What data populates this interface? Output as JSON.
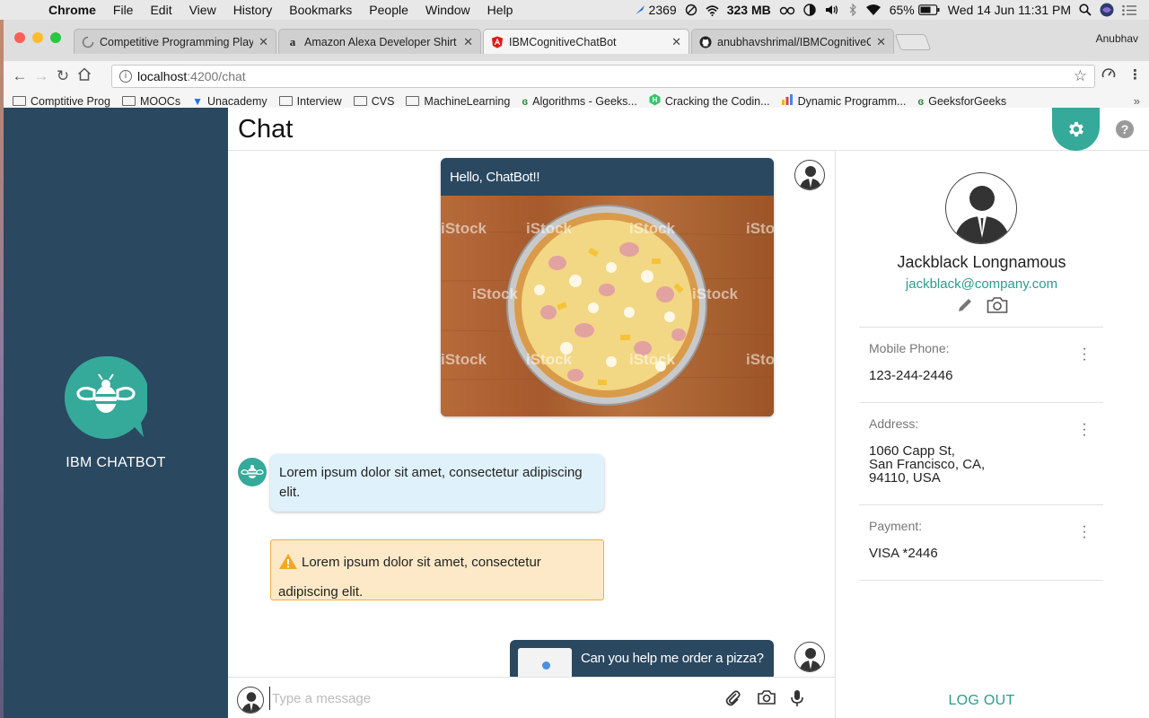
{
  "menubar": {
    "app_name": "Chrome",
    "items": [
      "File",
      "Edit",
      "View",
      "History",
      "Bookmarks",
      "People",
      "Window",
      "Help"
    ],
    "status_count": "2369",
    "memory": "323 MB",
    "battery": "65%",
    "clock": "Wed 14 Jun  11:31 PM"
  },
  "browser": {
    "tabs": [
      {
        "label": "Competitive Programming Play",
        "icon": "loading-icon"
      },
      {
        "label": "Amazon Alexa Developer Shirt",
        "icon": "amazon-icon"
      },
      {
        "label": "IBMCognitiveChatBot",
        "icon": "angular-icon"
      },
      {
        "label": "anubhavshrimal/IBMCognitiveC",
        "icon": "github-icon"
      }
    ],
    "profile": "Anubhav",
    "url_host": "localhost",
    "url_path": ":4200/chat",
    "bookmarks": [
      {
        "label": "Comptitive Prog",
        "icon": "folder-icon"
      },
      {
        "label": "MOOCs",
        "icon": "folder-icon"
      },
      {
        "label": "Unacademy",
        "icon": "unacademy-icon"
      },
      {
        "label": "Interview",
        "icon": "folder-icon"
      },
      {
        "label": "CVS",
        "icon": "folder-icon"
      },
      {
        "label": "MachineLearning",
        "icon": "folder-icon"
      },
      {
        "label": "Algorithms - Geeks...",
        "icon": "geeksforgeeks-icon"
      },
      {
        "label": "Cracking the Codin...",
        "icon": "hackerrank-icon"
      },
      {
        "label": "Dynamic Programm...",
        "icon": "chart-icon"
      },
      {
        "label": "GeeksforGeeks",
        "icon": "geeksforgeeks-icon"
      }
    ]
  },
  "app": {
    "brand": "IBM CHATBOT",
    "page_title": "Chat",
    "colors": {
      "sidebar": "#2a4860",
      "accent": "#35a99a",
      "link": "#2a9d8f"
    }
  },
  "chat": {
    "messages": [
      {
        "sender": "user",
        "text": "Hello, ChatBot!!",
        "watermark": "iStock"
      },
      {
        "sender": "bot",
        "text": "Lorem ipsum dolor sit amet, consectetur adipiscing elit."
      },
      {
        "sender": "bot",
        "type": "warning",
        "text": "Lorem ipsum dolor sit amet, consectetur adipiscing elit."
      },
      {
        "sender": "user",
        "text": "Can you help me order a pizza?"
      }
    ],
    "composer_placeholder": "Type a message"
  },
  "profile": {
    "name": "Jackblack Longnamous",
    "email": "jackblack@company.com",
    "fields": [
      {
        "label": "Mobile Phone:",
        "lines": [
          "123-244-2446"
        ]
      },
      {
        "label": "Address:",
        "lines": [
          "1060 Capp St,",
          "San Francisco, CA,",
          "94110, USA"
        ]
      },
      {
        "label": "Payment:",
        "lines": [
          "VISA *2446"
        ]
      }
    ],
    "logout": "LOG OUT"
  }
}
